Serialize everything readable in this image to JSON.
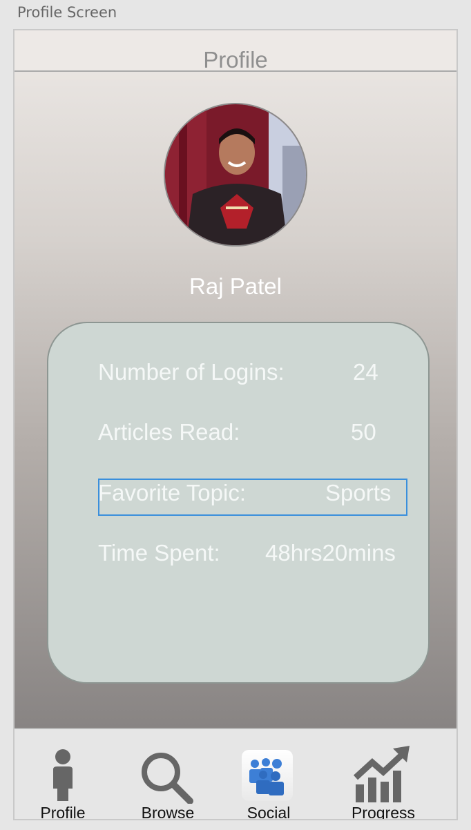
{
  "window": {
    "title": "Profile Screen"
  },
  "navbar": {
    "title": "Profile"
  },
  "profile": {
    "name": "Raj Patel",
    "stats": [
      {
        "label": "Number of Logins:",
        "value": "24"
      },
      {
        "label": "Articles Read:",
        "value": "50"
      },
      {
        "label": "Favorite Topic:",
        "value": "Sports"
      },
      {
        "label": "Time Spent:",
        "value": "48hrs20mins"
      }
    ]
  },
  "tabbar": {
    "tabs": [
      {
        "label": "Profile",
        "icon": "person-icon"
      },
      {
        "label": "Browse",
        "icon": "magnifier-icon"
      },
      {
        "label": "Social",
        "icon": "people-group-icon"
      },
      {
        "label": "Progress",
        "icon": "growth-chart-icon"
      }
    ]
  },
  "colors": {
    "card": "#ced7d3",
    "focus_ring": "#3a8fdc",
    "social_icon": "#3d7fd6",
    "icon_gray": "#666666"
  }
}
